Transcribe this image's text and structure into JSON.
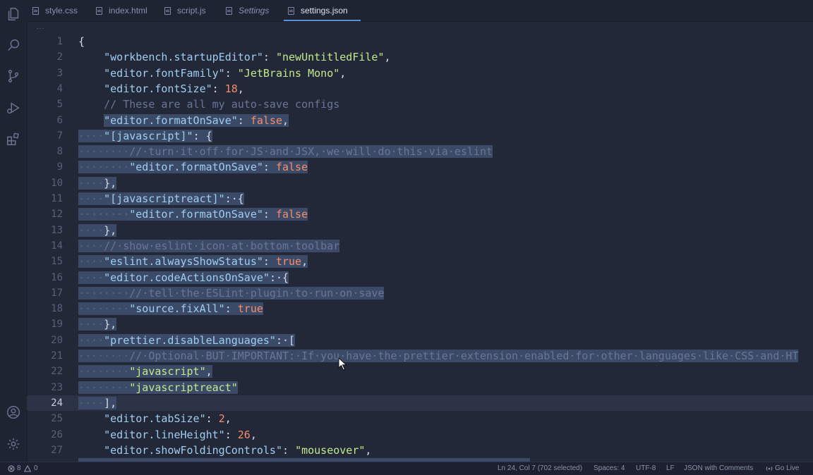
{
  "tabs": [
    {
      "label": "style.css"
    },
    {
      "label": "index.html"
    },
    {
      "label": "script.js"
    },
    {
      "label": "Settings"
    },
    {
      "label": "settings.json"
    }
  ],
  "breadcrumb": "...",
  "activity_icons": [
    "explorer-icon",
    "search-icon",
    "source-control-icon",
    "run-debug-icon",
    "extensions-icon",
    "account-icon",
    "gear-icon"
  ],
  "editor": {
    "current_line": 24,
    "lines": [
      [
        {
          "t": "{",
          "c": "p"
        }
      ],
      [
        {
          "t": "    "
        },
        {
          "t": "\"workbench.startupEditor\"",
          "c": "k"
        },
        {
          "t": ": ",
          "c": "p"
        },
        {
          "t": "\"newUntitledFile\"",
          "c": "s"
        },
        {
          "t": ",",
          "c": "p"
        }
      ],
      [
        {
          "t": "    "
        },
        {
          "t": "\"editor.fontFamily\"",
          "c": "k"
        },
        {
          "t": ": ",
          "c": "p"
        },
        {
          "t": "\"JetBrains Mono\"",
          "c": "s"
        },
        {
          "t": ",",
          "c": "p"
        }
      ],
      [
        {
          "t": "    "
        },
        {
          "t": "\"editor.fontSize\"",
          "c": "k"
        },
        {
          "t": ": ",
          "c": "p"
        },
        {
          "t": "18",
          "c": "n"
        },
        {
          "t": ",",
          "c": "p"
        }
      ],
      [
        {
          "t": "    "
        },
        {
          "t": "// These are all my auto-save configs",
          "c": "c"
        }
      ],
      [
        {
          "t": "    "
        },
        {
          "t": "\"editor.formatOnSave\"",
          "c": "k",
          "sel": true
        },
        {
          "t": ": ",
          "c": "p",
          "sel": true
        },
        {
          "t": "false",
          "c": "n",
          "sel": true
        },
        {
          "t": ",",
          "c": "p",
          "sel": true
        }
      ],
      [
        {
          "t": "····",
          "c": "ws",
          "sel": true
        },
        {
          "t": "\"[javascript]\"",
          "c": "k",
          "sel": true
        },
        {
          "t": ": {",
          "c": "p",
          "sel": true
        }
      ],
      [
        {
          "t": "········",
          "c": "ws",
          "sel": true
        },
        {
          "t": "//·turn·it·off·for·JS·and·JSX,·we·will·do·this·via·eslint",
          "c": "c",
          "sel": true
        }
      ],
      [
        {
          "t": "········",
          "c": "ws",
          "sel": true
        },
        {
          "t": "\"editor.formatOnSave\"",
          "c": "k",
          "sel": true
        },
        {
          "t": ": ",
          "c": "p",
          "sel": true
        },
        {
          "t": "false",
          "c": "n",
          "sel": true
        }
      ],
      [
        {
          "t": "····",
          "c": "ws",
          "sel": true
        },
        {
          "t": "},",
          "c": "p",
          "sel": true
        }
      ],
      [
        {
          "t": "····",
          "c": "ws",
          "sel": true
        },
        {
          "t": "\"[javascriptreact]\"",
          "c": "k",
          "sel": true
        },
        {
          "t": ":·{",
          "c": "p",
          "sel": true
        }
      ],
      [
        {
          "t": "········",
          "c": "ws",
          "sel": true
        },
        {
          "t": "\"editor.formatOnSave\"",
          "c": "k",
          "sel": true
        },
        {
          "t": ": ",
          "c": "p",
          "sel": true
        },
        {
          "t": "false",
          "c": "n",
          "sel": true
        }
      ],
      [
        {
          "t": "····",
          "c": "ws",
          "sel": true
        },
        {
          "t": "},",
          "c": "p",
          "sel": true
        }
      ],
      [
        {
          "t": "····",
          "c": "ws",
          "sel": true
        },
        {
          "t": "//·show·eslint·icon·at·bottom·toolbar",
          "c": "c",
          "sel": true
        }
      ],
      [
        {
          "t": "····",
          "c": "ws",
          "sel": true
        },
        {
          "t": "\"eslint.alwaysShowStatus\"",
          "c": "k",
          "sel": true
        },
        {
          "t": ": ",
          "c": "p",
          "sel": true
        },
        {
          "t": "true",
          "c": "n",
          "sel": true
        },
        {
          "t": ",",
          "c": "p",
          "sel": true
        }
      ],
      [
        {
          "t": "····",
          "c": "ws",
          "sel": true
        },
        {
          "t": "\"editor.codeActionsOnSave\"",
          "c": "k",
          "sel": true
        },
        {
          "t": ":·{",
          "c": "p",
          "sel": true
        }
      ],
      [
        {
          "t": "········",
          "c": "ws",
          "sel": true
        },
        {
          "t": "//·tell·the·ESLint·plugin·to·run·on·save",
          "c": "c",
          "sel": true
        }
      ],
      [
        {
          "t": "········",
          "c": "ws",
          "sel": true
        },
        {
          "t": "\"source.fixAll\"",
          "c": "k",
          "sel": true
        },
        {
          "t": ": ",
          "c": "p",
          "sel": true
        },
        {
          "t": "true",
          "c": "n",
          "sel": true
        }
      ],
      [
        {
          "t": "····",
          "c": "ws",
          "sel": true
        },
        {
          "t": "},",
          "c": "p",
          "sel": true
        }
      ],
      [
        {
          "t": "····",
          "c": "ws",
          "sel": true
        },
        {
          "t": "\"prettier.disableLanguages\"",
          "c": "k",
          "sel": true
        },
        {
          "t": ":·[",
          "c": "p",
          "sel": true
        }
      ],
      [
        {
          "t": "········",
          "c": "ws",
          "sel": true
        },
        {
          "t": "//·Optional·BUT·IMPORTANT:·If·you·have·the·prettier·extension·enabled·for·other·languages·like·CSS·and·HT",
          "c": "c",
          "sel": true
        }
      ],
      [
        {
          "t": "········",
          "c": "ws",
          "sel": true
        },
        {
          "t": "\"javascript\"",
          "c": "s",
          "sel": true
        },
        {
          "t": ",",
          "c": "p",
          "sel": true
        }
      ],
      [
        {
          "t": "········",
          "c": "ws",
          "sel": true
        },
        {
          "t": "\"javascriptreact\"",
          "c": "s",
          "sel": true
        }
      ],
      [
        {
          "t": "····",
          "c": "ws",
          "sel": true
        },
        {
          "t": "],",
          "c": "p",
          "sel": true
        }
      ],
      [
        {
          "t": "    "
        },
        {
          "t": "\"editor.tabSize\"",
          "c": "k"
        },
        {
          "t": ": ",
          "c": "p"
        },
        {
          "t": "2",
          "c": "n"
        },
        {
          "t": ",",
          "c": "p"
        }
      ],
      [
        {
          "t": "    "
        },
        {
          "t": "\"editor.lineHeight\"",
          "c": "k"
        },
        {
          "t": ": ",
          "c": "p"
        },
        {
          "t": "26",
          "c": "n"
        },
        {
          "t": ",",
          "c": "p"
        }
      ],
      [
        {
          "t": "    "
        },
        {
          "t": "\"editor.showFoldingControls\"",
          "c": "k"
        },
        {
          "t": ": ",
          "c": "p"
        },
        {
          "t": "\"mouseover\"",
          "c": "s"
        },
        {
          "t": ",",
          "c": "p"
        }
      ]
    ]
  },
  "status": {
    "errors": "8",
    "warnings": "0",
    "position": "Ln 24, Col 7 (702 selected)",
    "spaces": "Spaces: 4",
    "encoding": "UTF-8",
    "eol": "LF",
    "language": "JSON with Comments",
    "golive": "Go Live"
  }
}
